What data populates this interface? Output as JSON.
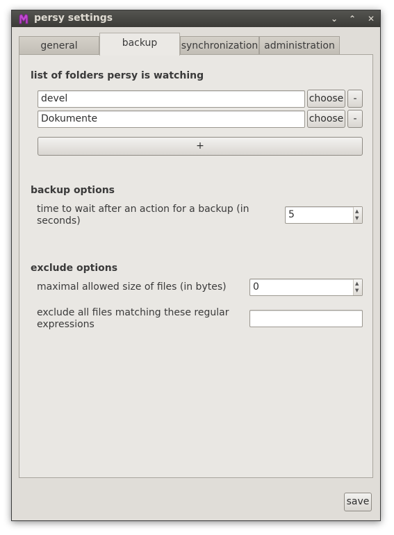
{
  "window": {
    "title": "persy settings"
  },
  "tabs": [
    "general",
    "backup",
    "synchronization",
    "administration"
  ],
  "folders": {
    "title": "list of folders persy is watching",
    "items": [
      {
        "value": "devel",
        "choose_label": "choose",
        "remove_label": "-"
      },
      {
        "value": "Dokumente",
        "choose_label": "choose",
        "remove_label": "-"
      }
    ],
    "add_label": "+"
  },
  "backup_options": {
    "title": "backup options",
    "wait_label": "time to wait after an action for a backup (in seconds)",
    "wait_value": "5"
  },
  "exclude_options": {
    "title": "exclude options",
    "maxsize_label": "maximal allowed size of files (in bytes)",
    "maxsize_value": "0",
    "regex_label": "exclude all files matching these regular expressions",
    "regex_value": ""
  },
  "save_label": "save",
  "colors": {
    "titlebar": "#3c3b37",
    "window_bg": "#e0ddd8",
    "app_icon": "#c04ad0"
  },
  "icons": [
    "app-icon",
    "minimize-icon",
    "maximize-icon",
    "close-icon",
    "spin-up-icon",
    "spin-down-icon"
  ]
}
